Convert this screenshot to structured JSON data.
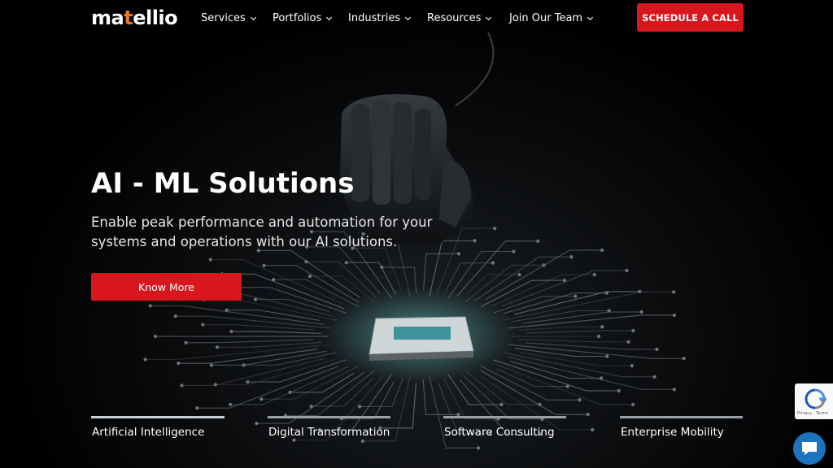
{
  "header": {
    "logo": {
      "part1": "ma",
      "part2": "t",
      "part3": "ellio"
    },
    "nav": [
      {
        "label": "Services"
      },
      {
        "label": "Portfolios"
      },
      {
        "label": "Industries"
      },
      {
        "label": "Resources"
      },
      {
        "label": "Join Our Team"
      }
    ],
    "cta_label": "SCHEDULE A CALL"
  },
  "hero": {
    "title": "AI - ML Solutions",
    "subtitle": "Enable peak performance and automation for your systems and operations with our AI solutions.",
    "button_label": "Know More"
  },
  "tabs": [
    {
      "label": "Artificial Intelligence",
      "progress": 1.0,
      "active": true
    },
    {
      "label": "Digital Transformation",
      "progress": 1.0,
      "active": false
    },
    {
      "label": "Software Consulting",
      "progress": 1.0,
      "active": false
    },
    {
      "label": "Enterprise Mobility",
      "progress": 1.0,
      "active": false
    }
  ],
  "recaptcha": {
    "terms": "Privacy - Terms",
    "icon": "recaptcha-icon"
  },
  "chat": {
    "icon": "chat-bubble-icon"
  },
  "colors": {
    "brand_red": "#d8161d",
    "logo_accent": "#e87a1c",
    "background": "#000000",
    "chat_blue": "#1e73be"
  }
}
